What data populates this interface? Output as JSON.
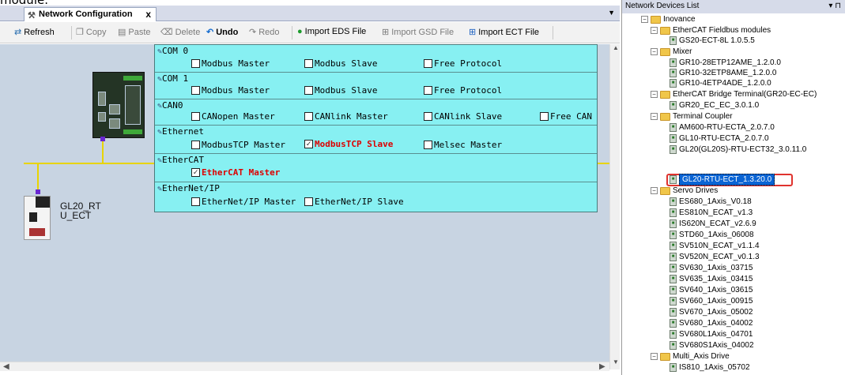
{
  "overflow_text": "module.",
  "tab": {
    "title": "Network Configuration",
    "close": "x"
  },
  "toolbar": {
    "refresh": "Refresh",
    "copy": "Copy",
    "paste": "Paste",
    "delete": "Delete",
    "undo": "Undo",
    "redo": "Redo",
    "import_eds": "Import EDS File",
    "import_gsd": "Import GSD File",
    "import_ect": "Import ECT File"
  },
  "device_label": "GL20_RT\nU_ECT",
  "device_label_lines": [
    "GL20_RT",
    "U_ECT"
  ],
  "config_panel": {
    "com0": {
      "title": "COM 0",
      "options": [
        {
          "label": "Modbus Master",
          "checked": false
        },
        {
          "label": "Modbus Slave",
          "checked": false
        },
        {
          "label": "Free Protocol",
          "checked": false
        }
      ]
    },
    "com1": {
      "title": "COM 1",
      "options": [
        {
          "label": "Modbus Master",
          "checked": false
        },
        {
          "label": "Modbus Slave",
          "checked": false
        },
        {
          "label": "Free Protocol",
          "checked": false
        }
      ]
    },
    "can0": {
      "title": "CAN0",
      "options": [
        {
          "label": "CANopen Master",
          "checked": false
        },
        {
          "label": "CANlink Master",
          "checked": false
        },
        {
          "label": "CANlink Slave",
          "checked": false
        },
        {
          "label": "Free CAN",
          "checked": false
        }
      ]
    },
    "ethernet": {
      "title": "Ethernet",
      "options": [
        {
          "label": "ModbusTCP Master",
          "checked": false
        },
        {
          "label": "ModbusTCP Slave",
          "checked": true
        },
        {
          "label": "Melsec Master",
          "checked": false
        }
      ]
    },
    "ethercat": {
      "title": "EtherCAT",
      "options": [
        {
          "label": "EtherCAT Master",
          "checked": true
        }
      ]
    },
    "ethernetip": {
      "title": "EtherNet/IP",
      "options": [
        {
          "label": "EtherNet/IP Master",
          "checked": false
        },
        {
          "label": "EtherNet/IP Slave",
          "checked": false
        }
      ]
    }
  },
  "devices_panel": {
    "title": "Network Devices List",
    "pin": "▾ ⊓",
    "tree": {
      "root": "Inovance",
      "ethercat_fieldbus": {
        "label": "EtherCAT Fieldbus modules",
        "items": [
          "GS20-ECT-8L 1.0.5.5"
        ]
      },
      "mixer": {
        "label": "Mixer",
        "items": [
          "GR10-28ETP12AME_1.2.0.0",
          "GR10-32ETP8AME_1.2.0.0",
          "GR10-4ETP4ADE_1.2.0.0"
        ]
      },
      "bridge": {
        "label": "EtherCAT Bridge Terminal(GR20-EC-EC)",
        "items": [
          "GR20_EC_EC_3.0.1.0"
        ]
      },
      "coupler": {
        "label": "Terminal Coupler",
        "items": [
          "AM600-RTU-ECTA_2.0.7.0",
          "GL10-RTU-ECTA_2.0.7.0",
          "GL20(GL20S)-RTU-ECT32_3.0.11.0",
          "GL20-RTU-ECT_1.3.20.0"
        ]
      },
      "servo": {
        "label": "Servo Drives",
        "items": [
          "ES680_1Axis_V0.18",
          "ES810N_ECAT_v1.3",
          "IS620N_ECAT_v2.6.9",
          "STD60_1Axis_06008",
          "SV510N_ECAT_v1.1.4",
          "SV520N_ECAT_v0.1.3",
          "SV630_1Axis_03715",
          "SV635_1Axis_03415",
          "SV640_1Axis_03615",
          "SV660_1Axis_00915",
          "SV670_1Axis_05002",
          "SV680_1Axis_04002",
          "SV680L1Axis_04701",
          "SV680S1Axis_04002"
        ]
      },
      "multi": {
        "label": "Multi_Axis Drive",
        "items": [
          "IS810_1Axis_05702"
        ]
      }
    },
    "selected": "GL20-RTU-ECT_1.3.20.0"
  }
}
